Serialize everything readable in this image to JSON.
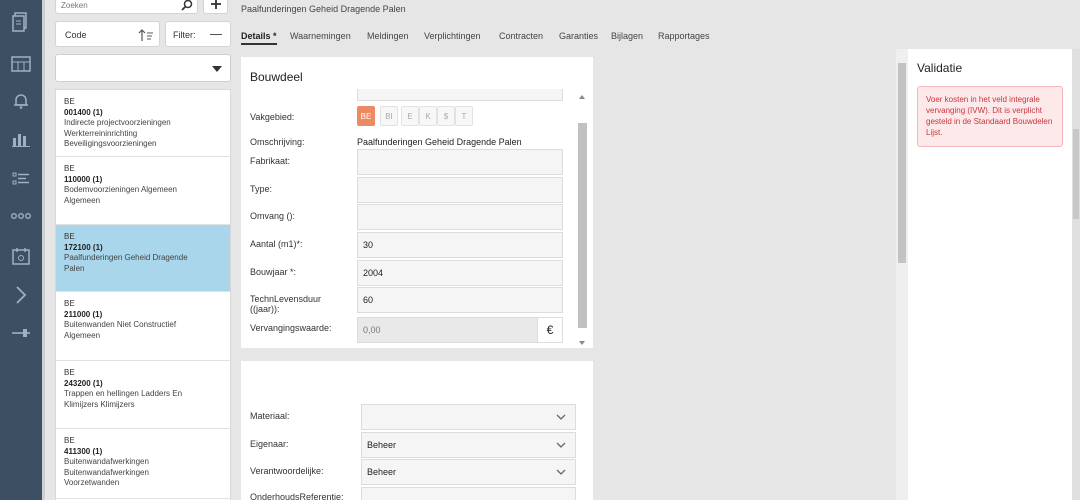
{
  "search": {
    "placeholder": "Zoeken"
  },
  "sort": {
    "label": "Code"
  },
  "filter": {
    "label": "Filter:"
  },
  "list": [
    {
      "type": "BE",
      "code": "001400 (1)",
      "lines": [
        "Indirecte projectvoorzieningen",
        "Werkterreininrichting",
        "Beveiligingsvoorzieningen"
      ]
    },
    {
      "type": "BE",
      "code": "110000 (1)",
      "lines": [
        "Bodemvoorzieningen Algemeen",
        "Algemeen"
      ]
    },
    {
      "type": "BE",
      "code": "172100 (1)",
      "lines": [
        "Paalfunderingen Geheid Dragende",
        "Palen"
      ]
    },
    {
      "type": "BE",
      "code": "211000 (1)",
      "lines": [
        "Buitenwanden Niet Constructief",
        "Algemeen"
      ]
    },
    {
      "type": "BE",
      "code": "243200 (1)",
      "lines": [
        "Trappen en hellingen Ladders En",
        "Klimijzers Klimijzers"
      ]
    },
    {
      "type": "BE",
      "code": "411300 (1)",
      "lines": [
        "Buitenwandafwerkingen",
        "Buitenwandafwerkingen",
        "Voorzetwanden"
      ]
    }
  ],
  "breadcrumb": "Paalfunderingen Geheid Dragende Palen",
  "tabs": [
    "Details *",
    "Waarnemingen",
    "Meldingen",
    "Verplichtingen",
    "Contracten",
    "Garanties",
    "Bijlagen",
    "Rapportages"
  ],
  "bouwdeel": {
    "title": "Bouwdeel",
    "vakgebied_label": "Vakgebied:",
    "vakgebied_options": [
      "BE",
      "BI",
      "E",
      "K",
      "$",
      "T"
    ],
    "vakgebied_selected": "BE",
    "omschrijving_label": "Omschrijving:",
    "omschrijving_value": "Paalfunderingen Geheid Dragende Palen",
    "fabrikaat_label": "Fabrikaat:",
    "fabrikaat_value": "",
    "type_label": "Type:",
    "type_value": "",
    "omvang_label": "Omvang ():",
    "omvang_value": "",
    "aantal_label": "Aantal (m1)*:",
    "aantal_value": "30",
    "bouwjaar_label": "Bouwjaar *:",
    "bouwjaar_value": "2004",
    "techn_label_1": "TechnLevensduur",
    "techn_label_2": "((jaar)):",
    "techn_value": "60",
    "vervanging_label": "Vervangingswaarde:",
    "vervanging_value": "0,00",
    "currency_symbol": "€"
  },
  "extra": {
    "materiaal_label": "Materiaal:",
    "materiaal_value": "",
    "eigenaar_label": "Eigenaar:",
    "eigenaar_value": "Beheer",
    "verantwoordelijke_label": "Verantwoordelijke:",
    "verantwoordelijke_value": "Beheer",
    "onderhoud_label": "OnderhoudsReferentie:"
  },
  "validatie": {
    "title": "Validatie",
    "message": "Voer kosten in het veld integrale vervanging (IVW). Dit is verplicht gesteld in de Standaard Bouwdelen Lijst."
  },
  "colors": {
    "rail": "#3d4f63",
    "selected_row": "#a9d6ea",
    "accent_orange": "#ee8a63",
    "error_text": "#c9363e",
    "error_bg": "#fde9ea"
  }
}
